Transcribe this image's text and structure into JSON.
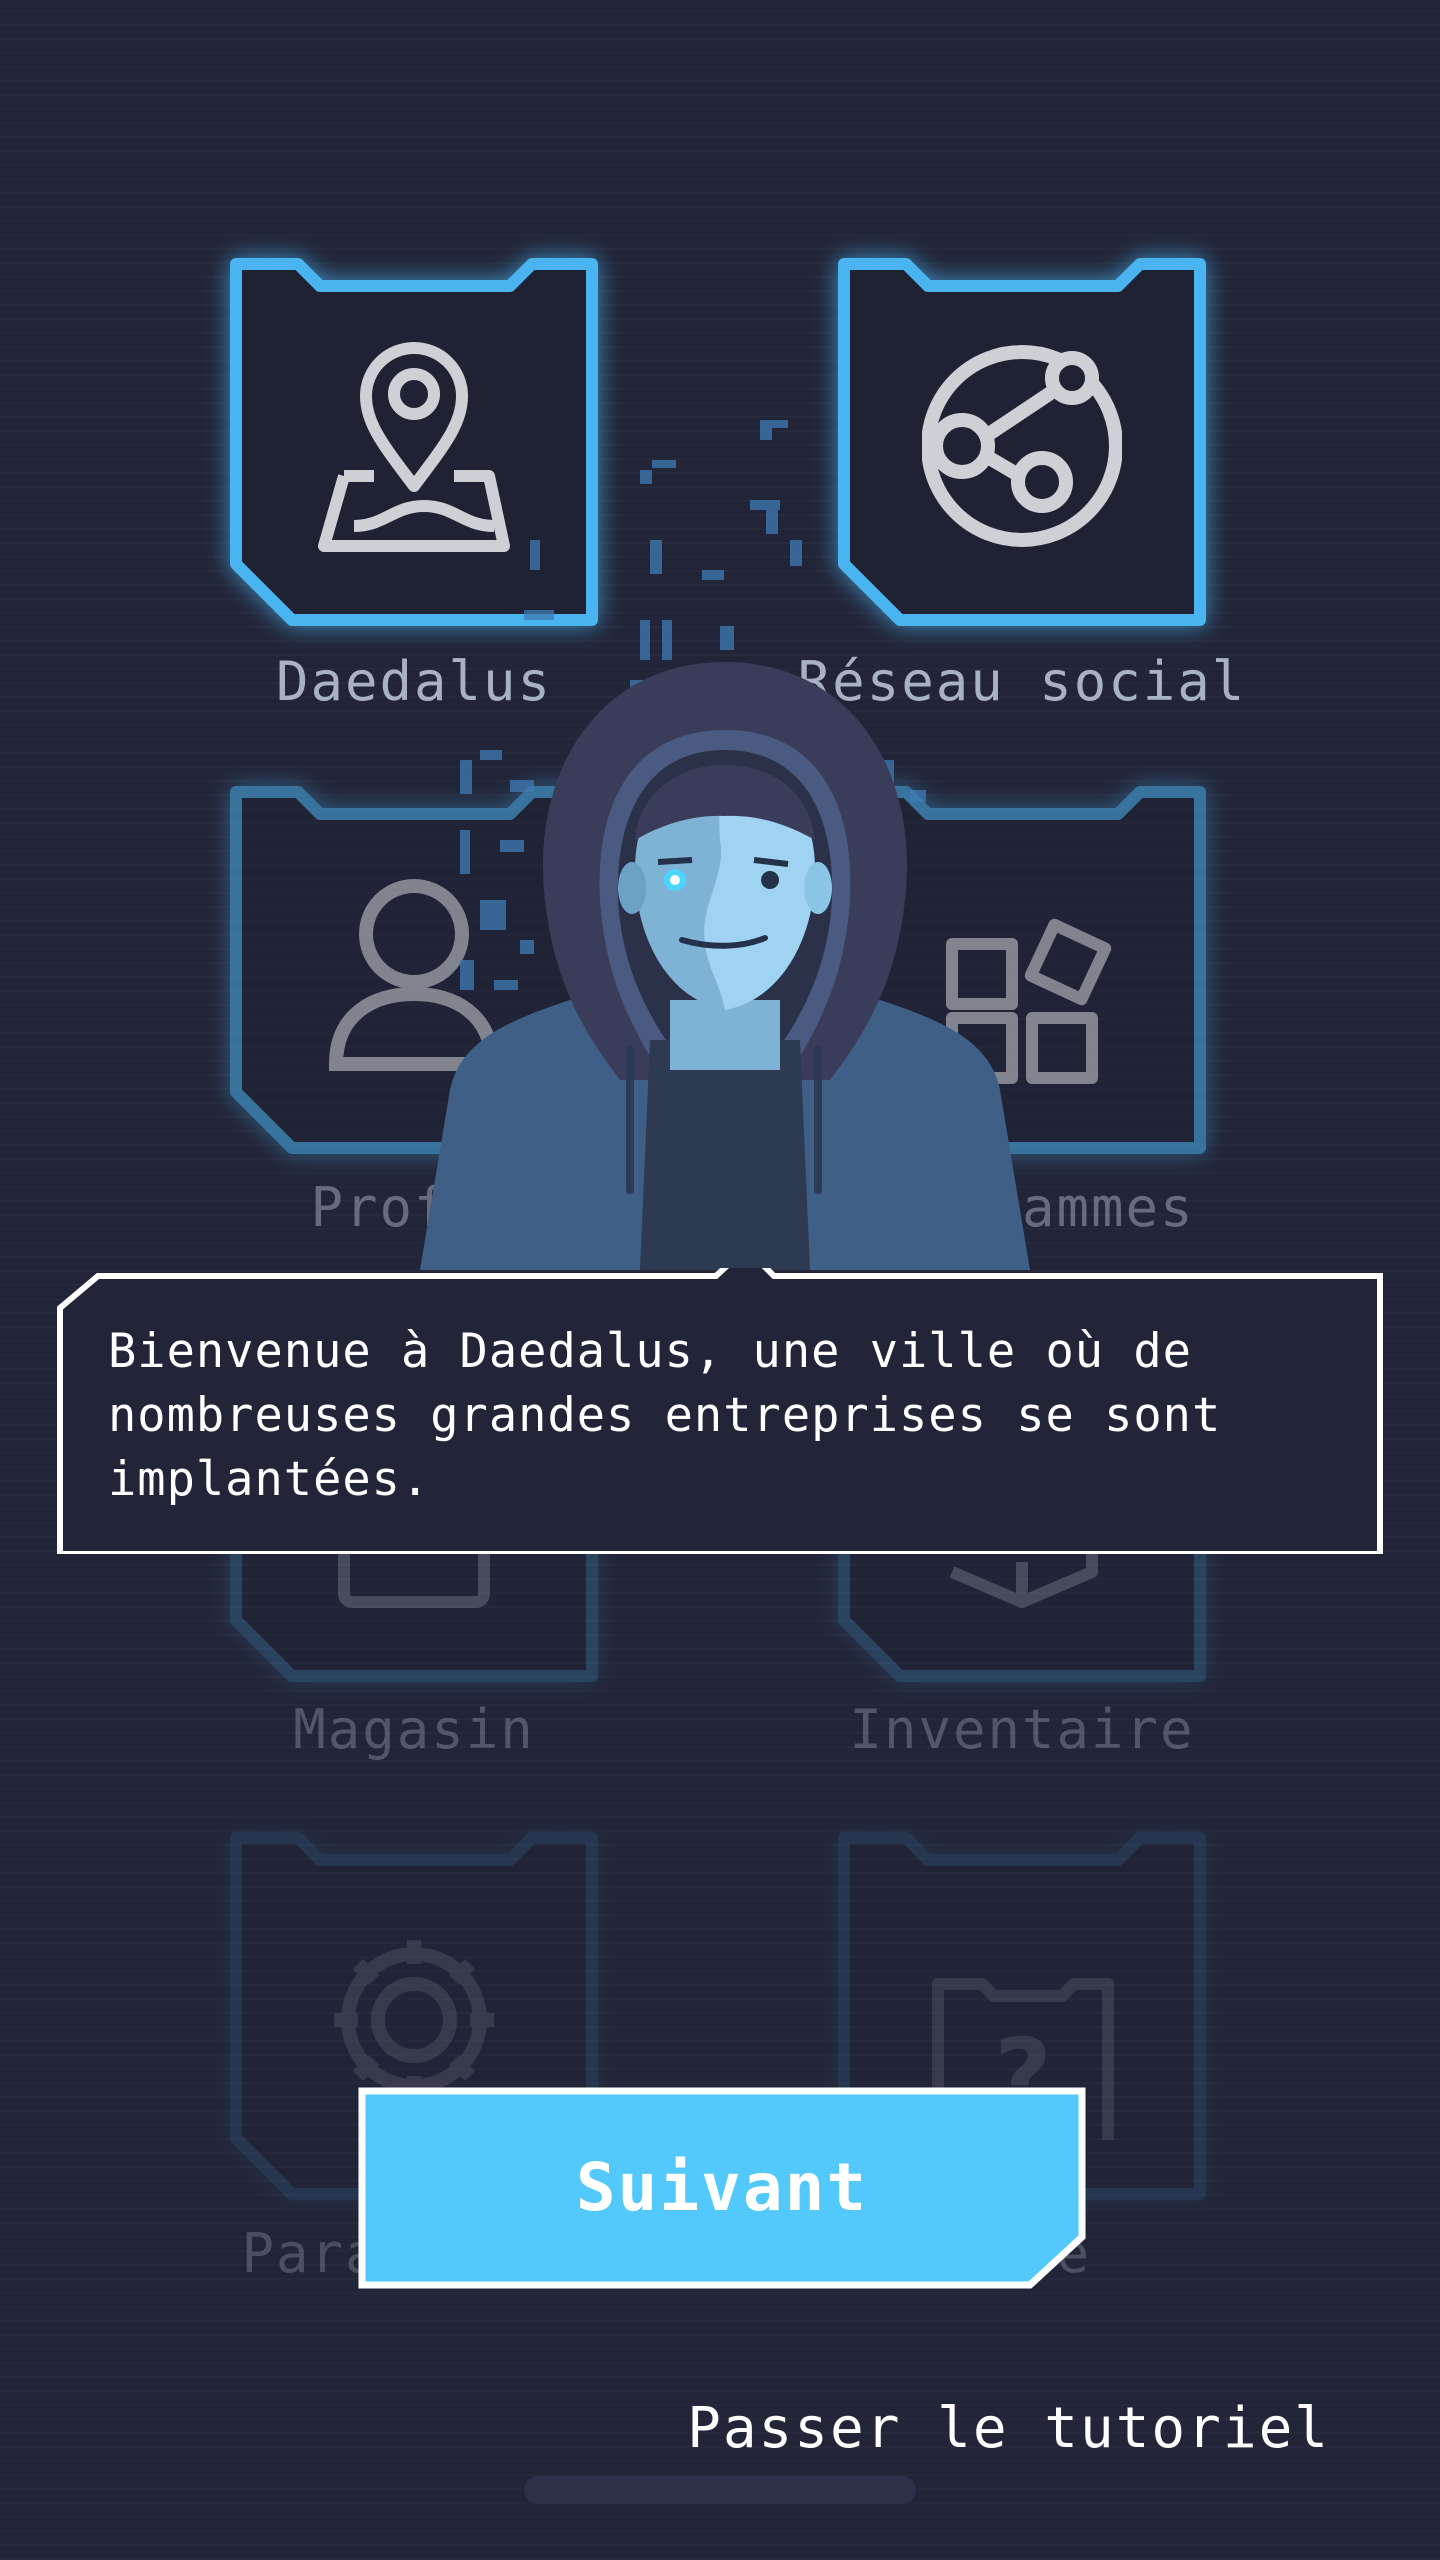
{
  "menu": {
    "tiles": [
      {
        "label": "Daedalus",
        "icon": "map-pin-icon"
      },
      {
        "label": "Réseau social",
        "icon": "globe-network-icon"
      },
      {
        "label": "Profil",
        "icon": "user-icon"
      },
      {
        "label": "Programmes",
        "icon": "apps-grid-icon"
      },
      {
        "label": "Magasin",
        "icon": "shop-icon"
      },
      {
        "label": "Inventaire",
        "icon": "box-icon"
      },
      {
        "label": "Paramètres",
        "icon": "gear-icon"
      },
      {
        "label": "Aide",
        "icon": "help-folder-icon"
      }
    ]
  },
  "tutorial": {
    "character": "hooded-hacker-avatar",
    "message": "Bienvenue à Daedalus, une ville où de nombreuses grandes entreprises se sont implantées.",
    "next_label": "Suivant",
    "skip_label": "Passer le tutoriel"
  },
  "colors": {
    "background": "#222538",
    "tile_glow": "#4ab4f0",
    "accent_button": "#52c8fb",
    "dialog_border": "#ffffff"
  }
}
